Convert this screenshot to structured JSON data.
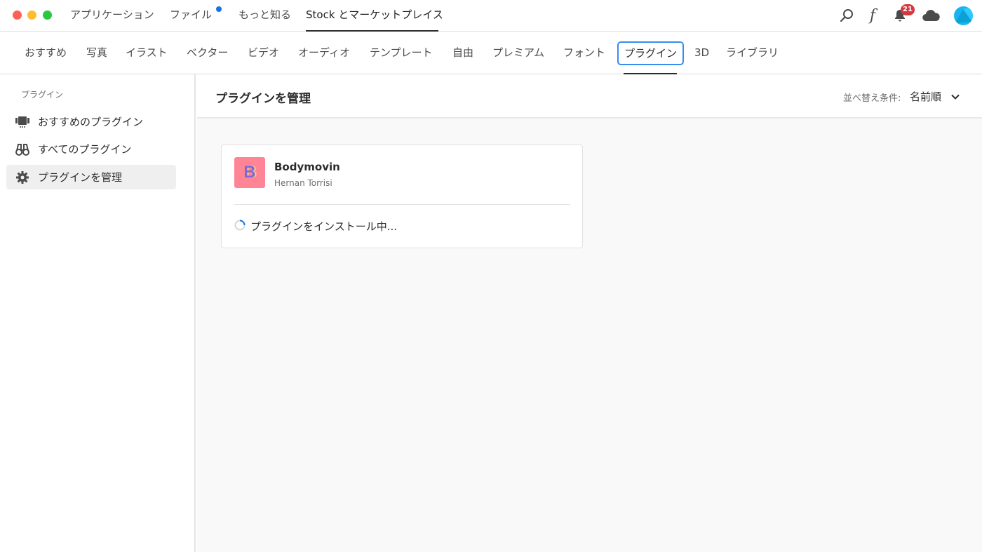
{
  "topnav": {
    "tabs": [
      {
        "label": "アプリケーション"
      },
      {
        "label": "ファイル"
      },
      {
        "label": "もっと知る"
      },
      {
        "label": "Stock とマーケットプレイス"
      }
    ],
    "notification_count": "21",
    "font_glyph": "f"
  },
  "categories": [
    "おすすめ",
    "写真",
    "イラスト",
    "ベクター",
    "ビデオ",
    "オーディオ",
    "テンプレート",
    "自由",
    "プレミアム",
    "フォント",
    "プラグイン",
    "3D",
    "ライブラリ"
  ],
  "sidebar": {
    "heading": "プラグイン",
    "items": [
      {
        "label": "おすすめのプラグイン",
        "icon": "featured-icon"
      },
      {
        "label": "すべてのプラグイン",
        "icon": "binoculars-icon"
      },
      {
        "label": "プラグインを管理",
        "icon": "gear-icon"
      }
    ]
  },
  "main": {
    "title": "プラグインを管理",
    "sort_label": "並べ替え条件:",
    "sort_value": "名前順"
  },
  "plugin": {
    "name": "Bodymovin",
    "author": "Hernan Torrisi",
    "icon_letter": "B",
    "status": "プラグインをインストール中..."
  },
  "colors": {
    "accent_blue": "#1473e6",
    "focus_ring": "#378ef0",
    "badge_red": "#d7373f",
    "plugin_icon_bg": "#ff8596",
    "avatar": "#19b4ef"
  }
}
